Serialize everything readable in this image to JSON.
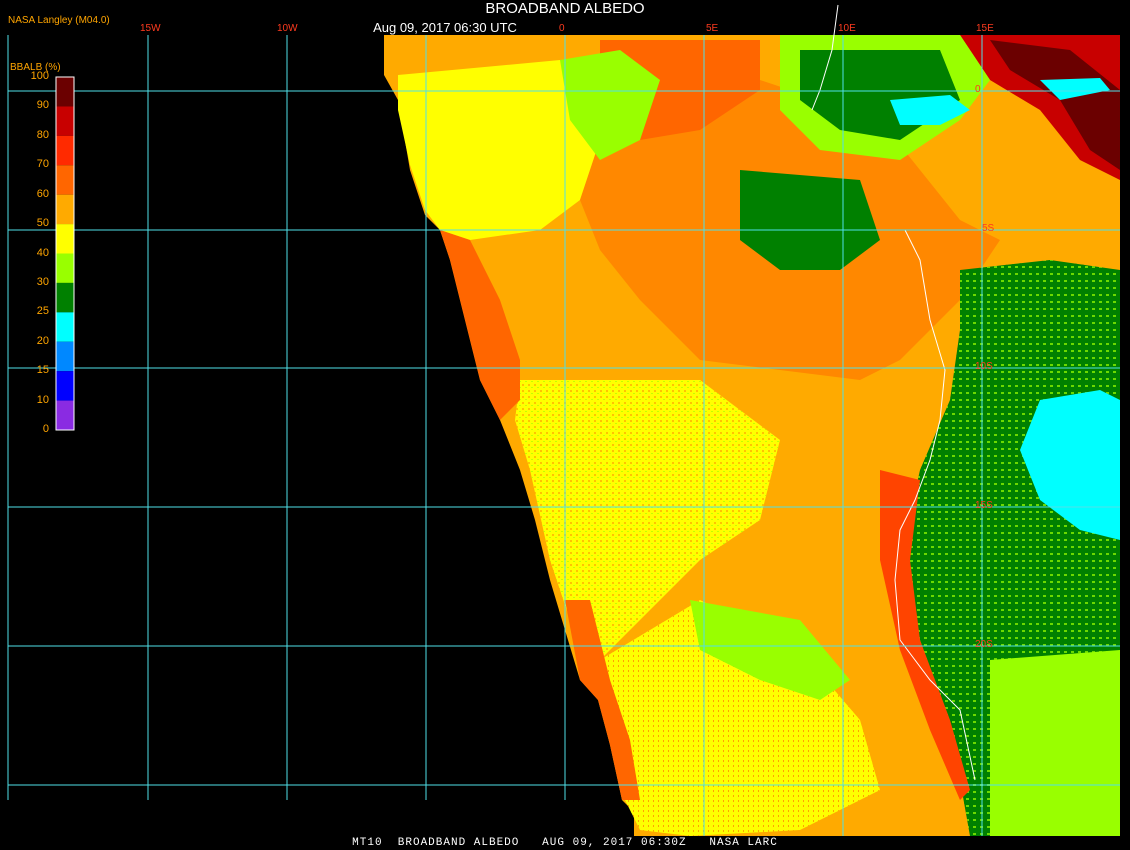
{
  "header": {
    "title": "BROADBAND ALBEDO",
    "subtitle": "Aug 09, 2017 06:30 UTC",
    "credit": "NASA Langley (M04.0)"
  },
  "legend": {
    "title": "BBALB (%)",
    "labels": [
      "100",
      "90",
      "80",
      "70",
      "60",
      "50",
      "40",
      "30",
      "25",
      "20",
      "15",
      "10",
      "0"
    ],
    "colors": [
      "#6b0000",
      "#c80000",
      "#ff2a00",
      "#ff6600",
      "#ffaa00",
      "#ffff00",
      "#99ff00",
      "#008000",
      "#00ffff",
      "#0088ff",
      "#0000ff",
      "#8a2be2"
    ]
  },
  "grid": {
    "lon_labels": [
      "15W",
      "10W",
      "0",
      "5E",
      "10E",
      "15E"
    ],
    "lat_labels": [
      "0",
      "5S",
      "10S",
      "15S",
      "20S"
    ],
    "line_color": "#4fe0e8",
    "label_color": "#ff3b1f"
  },
  "footer": {
    "text": "MT10  BROADBAND ALBEDO   AUG 09, 2017 06:30Z   NASA LARC"
  }
}
